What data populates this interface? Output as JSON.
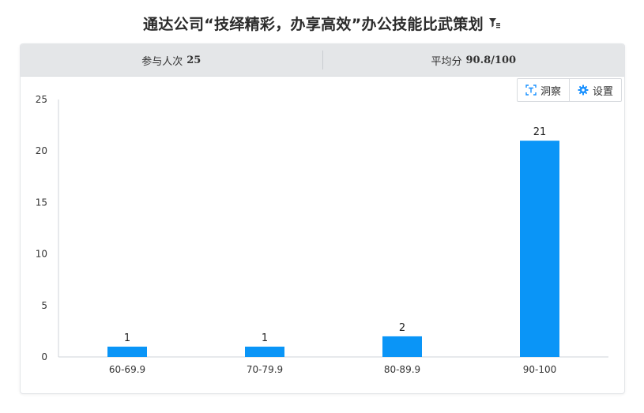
{
  "header": {
    "title": "通达公司“技绎精彩，办享高效”办公技能比武策划",
    "filter_icon": "filter-list-icon"
  },
  "stats": {
    "participants_label": "参与人次",
    "participants_value": "25",
    "average_label": "平均分",
    "average_value": "90.8/100"
  },
  "toolbar": {
    "insight_label": "洞察",
    "insight_icon": "text-scan-icon",
    "settings_label": "设置",
    "settings_icon": "gear-icon"
  },
  "colors": {
    "bar": "#0a95f7",
    "icon_accent": "#1890ff"
  },
  "chart_data": {
    "type": "bar",
    "categories": [
      "60-69.9",
      "70-79.9",
      "80-89.9",
      "90-100"
    ],
    "values": [
      1,
      1,
      2,
      21
    ],
    "ylim": [
      0,
      25
    ],
    "yticks": [
      0,
      5,
      10,
      15,
      20,
      25
    ],
    "grid": false,
    "data_labels": true
  }
}
